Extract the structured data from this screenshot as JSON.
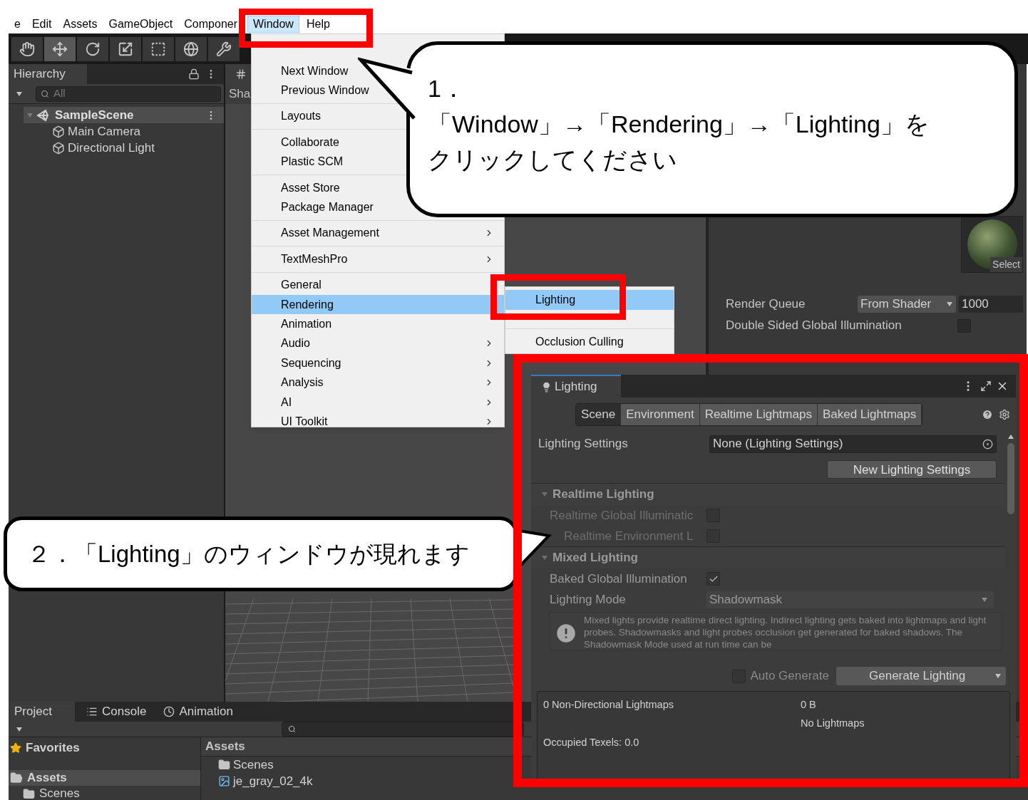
{
  "menu_bar": [
    {
      "label": "e",
      "selected": false
    },
    {
      "label": "Edit",
      "selected": false
    },
    {
      "label": "Assets",
      "selected": false
    },
    {
      "label": "GameObject",
      "selected": false
    },
    {
      "label": "Componer",
      "selected": false
    },
    {
      "label": "Window",
      "selected": true
    },
    {
      "label": "Help",
      "selected": false
    }
  ],
  "toolbar": {
    "tools": [
      {
        "kind": "hand",
        "selected": false
      },
      {
        "kind": "move",
        "selected": true
      },
      {
        "kind": "rotate",
        "selected": false
      },
      {
        "kind": "scale",
        "selected": false
      },
      {
        "kind": "rect",
        "selected": false
      },
      {
        "kind": "transform",
        "selected": false
      },
      {
        "kind": "custom",
        "selected": false
      }
    ]
  },
  "hierarchy": {
    "title": "Hierarchy",
    "search": {
      "placeholder": "All"
    },
    "scene": {
      "name": "SampleScene",
      "expanded": true,
      "children": [
        {
          "name": "Main Camera"
        },
        {
          "name": "Directional Light"
        }
      ]
    }
  },
  "scene_view": {
    "toolbar_label": "Sha"
  },
  "inspector": {
    "preview_button": "Select",
    "render_queue": {
      "label": "Render Queue",
      "mode": "From Shader",
      "value": "1000"
    },
    "double_sided_gi": {
      "label": "Double Sided Global Illumination",
      "checked": false
    }
  },
  "window_menu": {
    "groups": [
      {
        "items": [
          {
            "label": "Next Window",
            "submenu": false,
            "selected": false
          },
          {
            "label": "Previous Window",
            "submenu": false,
            "selected": false
          }
        ]
      },
      {
        "items": [
          {
            "label": "Layouts",
            "submenu": false,
            "selected": false
          }
        ]
      },
      {
        "items": [
          {
            "label": "Collaborate",
            "submenu": false,
            "selected": false
          },
          {
            "label": "Plastic SCM",
            "submenu": false,
            "selected": false
          }
        ]
      },
      {
        "items": [
          {
            "label": "Asset Store",
            "submenu": false,
            "selected": false
          },
          {
            "label": "Package Manager",
            "submenu": false,
            "selected": false
          }
        ]
      },
      {
        "items": [
          {
            "label": "Asset Management",
            "submenu": true,
            "selected": false
          }
        ]
      },
      {
        "items": [
          {
            "label": "TextMeshPro",
            "submenu": true,
            "selected": false
          }
        ]
      },
      {
        "items": [
          {
            "label": "General",
            "submenu": false,
            "selected": false
          },
          {
            "label": "Rendering",
            "submenu": false,
            "selected": true
          },
          {
            "label": "Animation",
            "submenu": false,
            "selected": false
          },
          {
            "label": "Audio",
            "submenu": true,
            "selected": false
          },
          {
            "label": "Sequencing",
            "submenu": true,
            "selected": false
          },
          {
            "label": "Analysis",
            "submenu": true,
            "selected": false
          },
          {
            "label": "AI",
            "submenu": true,
            "selected": false
          },
          {
            "label": "UI Toolkit",
            "submenu": true,
            "selected": false
          }
        ]
      }
    ]
  },
  "rendering_submenu": {
    "items": [
      {
        "label": "Lighting",
        "selected": true
      },
      {
        "label": "Occlusion Culling",
        "selected": false
      }
    ]
  },
  "lighting_window": {
    "title": "Lighting",
    "tabs": [
      {
        "label": "Scene",
        "selected": true
      },
      {
        "label": "Environment",
        "selected": false
      },
      {
        "label": "Realtime Lightmaps",
        "selected": false
      },
      {
        "label": "Baked Lightmaps",
        "selected": false
      }
    ],
    "settings": {
      "label": "Lighting Settings",
      "value": "None (Lighting Settings)",
      "button": "New Lighting Settings"
    },
    "sections": [
      {
        "title": "Realtime Lighting",
        "expanded": true,
        "rows": [
          {
            "kind": "checkbox",
            "label": "Realtime Global Illuminatic",
            "checked": false,
            "disabled": true,
            "children": [
              {
                "kind": "checkbox",
                "label": "Realtime Environment L",
                "checked": false,
                "disabled": true
              }
            ]
          }
        ]
      },
      {
        "title": "Mixed Lighting",
        "expanded": true,
        "rows": [
          {
            "kind": "checkbox",
            "label": "Baked Global Illumination",
            "checked": true,
            "disabled": false
          },
          {
            "kind": "dropdown",
            "label": "Lighting Mode",
            "value": "Shadowmask",
            "disabled": false
          },
          {
            "kind": "help",
            "text": "Mixed lights provide realtime direct lighting. Indirect lighting gets baked into lightmaps and light probes. Shadowmasks and light probes occlusion get generated for baked shadows. The Shadowmask Mode used at run time can be"
          }
        ]
      }
    ],
    "auto_generate": {
      "label": "Auto Generate",
      "checked": false
    },
    "generate_button": "Generate Lighting",
    "stats": {
      "lightmaps": "0 Non-Directional Lightmaps",
      "size": "0 B",
      "status": "No Lightmaps",
      "texels": "Occupied Texels: 0.0"
    }
  },
  "bottom_panel": {
    "tabs": [
      {
        "label": "Project",
        "kind": "project",
        "selected": true
      },
      {
        "label": "Console",
        "kind": "console",
        "selected": false
      },
      {
        "label": "Animation",
        "kind": "animation",
        "selected": false
      }
    ],
    "tree": [
      {
        "label": "Favorites",
        "kind": "favorites",
        "selected": false
      },
      {
        "label": "Assets",
        "kind": "folder",
        "selected": true,
        "children": [
          {
            "label": "Scenes",
            "kind": "folder",
            "selected": false
          }
        ]
      }
    ],
    "breadcrumb": "Assets",
    "items": [
      {
        "label": "Scenes",
        "kind": "folder"
      },
      {
        "label": "je_gray_02_4k",
        "kind": "texture"
      }
    ]
  },
  "callout_step1": {
    "lines": [
      "1．",
      "「Window」→「Rendering」→「Lighting」を",
      "クリックしてください"
    ]
  },
  "callout_step2": {
    "text": "２．「Lighting」のウィンドウが現れます"
  }
}
